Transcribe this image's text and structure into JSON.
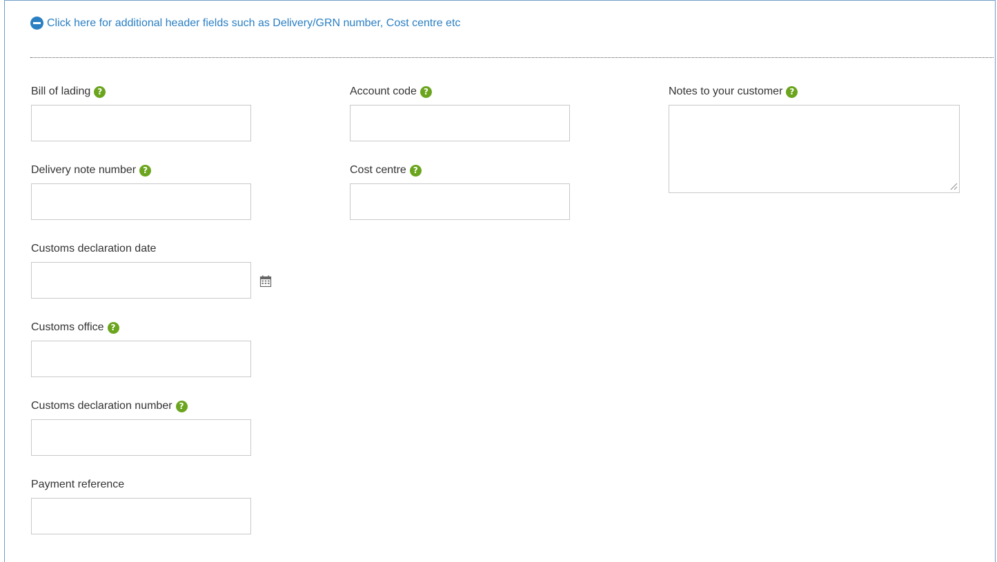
{
  "header": {
    "toggle_label": "Click here for additional header fields such as Delivery/GRN number, Cost centre etc"
  },
  "fields": {
    "bill_of_lading": {
      "label": "Bill of lading",
      "value": ""
    },
    "delivery_note_number": {
      "label": "Delivery note number",
      "value": ""
    },
    "customs_declaration_date": {
      "label": "Customs declaration date",
      "value": ""
    },
    "customs_office": {
      "label": "Customs office",
      "value": ""
    },
    "customs_declaration_number": {
      "label": "Customs declaration number",
      "value": ""
    },
    "payment_reference": {
      "label": "Payment reference",
      "value": ""
    },
    "account_code": {
      "label": "Account code",
      "value": ""
    },
    "cost_centre": {
      "label": "Cost centre",
      "value": ""
    },
    "notes_to_customer": {
      "label": "Notes to your customer",
      "value": ""
    }
  },
  "help_glyph": "?",
  "icons": {
    "toggle": "minus-circle-icon",
    "help": "question-circle-icon",
    "calendar": "calendar-icon"
  },
  "colors": {
    "link": "#2a7fc3",
    "help_icon": "#6ba51e",
    "panel_border": "#6f9bc8",
    "input_border": "#c8c8c8"
  }
}
